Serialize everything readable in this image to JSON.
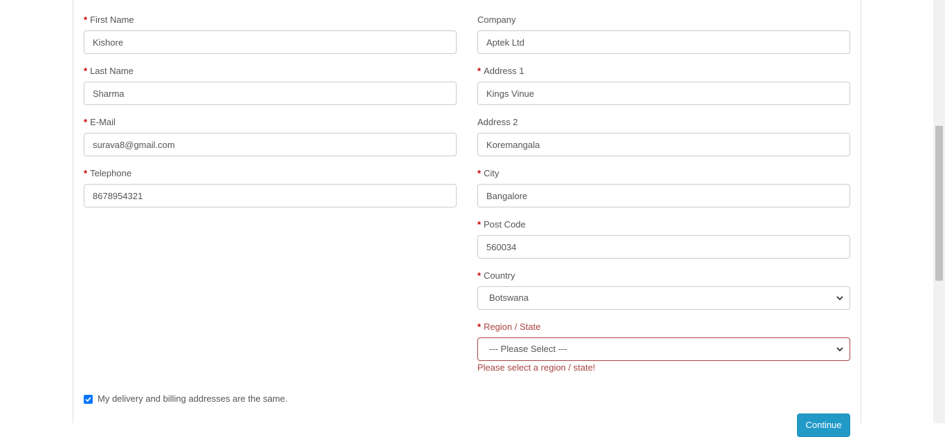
{
  "form": {
    "first_name": {
      "label": "First Name",
      "value": "Kishore",
      "required": true
    },
    "last_name": {
      "label": "Last Name",
      "value": "Sharma",
      "required": true
    },
    "email": {
      "label": "E-Mail",
      "value": "surava8@gmail.com",
      "required": true
    },
    "telephone": {
      "label": "Telephone",
      "value": "8678954321",
      "required": true
    },
    "company": {
      "label": "Company",
      "value": "Aptek Ltd",
      "required": false
    },
    "address1": {
      "label": "Address 1",
      "value": "Kings Vinue",
      "required": true
    },
    "address2": {
      "label": "Address 2",
      "value": "Koremangala",
      "required": false
    },
    "city": {
      "label": "City",
      "value": "Bangalore",
      "required": true
    },
    "postcode": {
      "label": "Post Code",
      "value": "560034",
      "required": true
    },
    "country": {
      "label": "Country",
      "selected": "Botswana",
      "required": true
    },
    "region": {
      "label": "Region / State",
      "selected": "--- Please Select ---",
      "required": true,
      "error": "Please select a region / state!"
    },
    "required_marker": "*",
    "same_address": {
      "label": "My delivery and billing addresses are the same.",
      "checked": true
    },
    "continue_label": "Continue"
  },
  "colors": {
    "required": "#cc0000",
    "error": "#a94442",
    "checkbox": "#0075ff",
    "button": "#229ac8"
  }
}
